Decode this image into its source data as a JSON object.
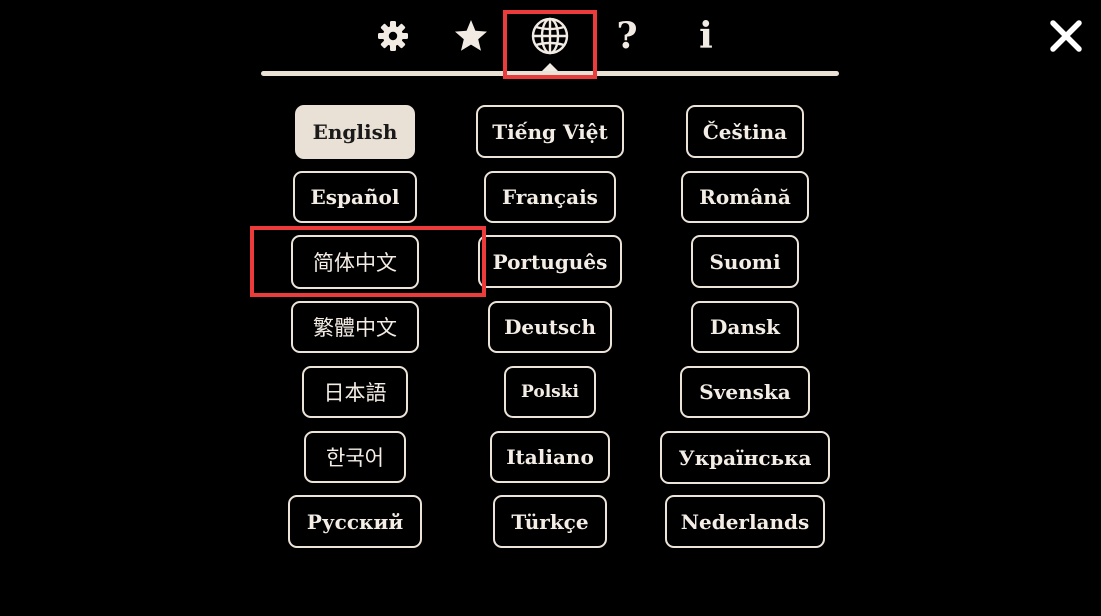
{
  "tabs": [
    {
      "icon": "gear-icon"
    },
    {
      "icon": "star-icon"
    },
    {
      "icon": "globe-icon",
      "active": true
    },
    {
      "icon": "question-icon",
      "text": "?"
    },
    {
      "icon": "info-icon",
      "text": "i"
    }
  ],
  "close_icon": "close-icon",
  "colors": {
    "background": "#000000",
    "foreground": "#f2ebe3",
    "selected_fill": "#e9e0d6",
    "highlight_box": "#ec3b3b"
  },
  "languages": {
    "col1": [
      "English",
      "Español",
      "简体中文",
      "繁體中文",
      "日本語",
      "한국어",
      "Русский"
    ],
    "col2": [
      "Tiếng Việt",
      "Français",
      "Português",
      "Deutsch",
      "Polski",
      "Italiano",
      "Türkçe"
    ],
    "col3": [
      "Čeština",
      "Română",
      "Suomi",
      "Dansk",
      "Svenska",
      "Українська",
      "Nederlands"
    ]
  },
  "selected_language": "English"
}
